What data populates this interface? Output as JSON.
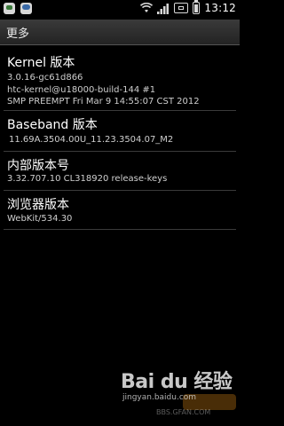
{
  "status_bar": {
    "time": "13:12",
    "icons": [
      "message-icon",
      "chat-icon",
      "wifi-icon",
      "signal-icon",
      "alarm-icon",
      "battery-icon"
    ]
  },
  "title": "更多",
  "items": [
    {
      "title": "Kernel 版本",
      "lines": [
        "3.0.16-gc61d866",
        "htc-kernel@u18000-build-144 #1",
        "SMP PREEMPT Fri Mar 9 14:55:07 CST 2012"
      ]
    },
    {
      "title": "Baseband 版本",
      "lines": [
        "11.69A.3504.00U_11.23.3504.07_M2"
      ]
    },
    {
      "title": "内部版本号",
      "lines": [
        "3.32.707.10 CL318920 release-keys"
      ]
    },
    {
      "title": "浏览器版本",
      "lines": [
        "WebKit/534.30"
      ]
    }
  ],
  "watermark": {
    "brand": "Bai du 经验",
    "url": "jingyan.baidu.com",
    "site": "BBS.GFAN.COM"
  }
}
